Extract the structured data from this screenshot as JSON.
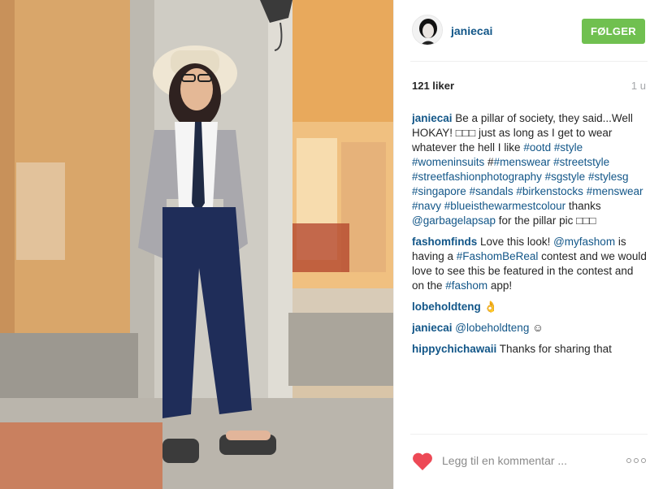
{
  "post": {
    "username": "janiecai",
    "follow_label": "FØLGER",
    "likes": "121 liker",
    "time": "1 u"
  },
  "comments": [
    {
      "user": "janiecai",
      "parts": [
        {
          "type": "text",
          "value": "Be a pillar of society, they said...Well HOKAY! "
        },
        {
          "type": "text",
          "value": "□□□"
        },
        {
          "type": "text",
          "value": " just as long as I get to wear whatever the hell I like "
        },
        {
          "type": "tag",
          "value": "#ootd"
        },
        {
          "type": "text",
          "value": " "
        },
        {
          "type": "tag",
          "value": "#style"
        },
        {
          "type": "text",
          "value": " "
        },
        {
          "type": "tag",
          "value": "#womeninsuits"
        },
        {
          "type": "text",
          "value": " #"
        },
        {
          "type": "tag",
          "value": "#menswear"
        },
        {
          "type": "text",
          "value": " "
        },
        {
          "type": "tag",
          "value": "#streetstyle"
        },
        {
          "type": "text",
          "value": " "
        },
        {
          "type": "tag",
          "value": "#streetfashionphotography"
        },
        {
          "type": "text",
          "value": " "
        },
        {
          "type": "tag",
          "value": "#sgstyle"
        },
        {
          "type": "text",
          "value": " "
        },
        {
          "type": "tag",
          "value": "#stylesg"
        },
        {
          "type": "text",
          "value": " "
        },
        {
          "type": "tag",
          "value": "#singapore"
        },
        {
          "type": "text",
          "value": " "
        },
        {
          "type": "tag",
          "value": "#sandals"
        },
        {
          "type": "text",
          "value": " "
        },
        {
          "type": "tag",
          "value": "#birkenstocks"
        },
        {
          "type": "text",
          "value": " "
        },
        {
          "type": "tag",
          "value": "#menswear"
        },
        {
          "type": "text",
          "value": " "
        },
        {
          "type": "tag",
          "value": "#navy"
        },
        {
          "type": "text",
          "value": " "
        },
        {
          "type": "tag",
          "value": "#blueisthewarmestcolour"
        },
        {
          "type": "text",
          "value": " thanks "
        },
        {
          "type": "mention",
          "value": "@garbagelapsap"
        },
        {
          "type": "text",
          "value": " for the pillar pic "
        },
        {
          "type": "text",
          "value": "□□□"
        }
      ]
    },
    {
      "user": "fashomfinds",
      "parts": [
        {
          "type": "text",
          "value": "Love this look! "
        },
        {
          "type": "mention",
          "value": "@myfashom"
        },
        {
          "type": "text",
          "value": " is having a "
        },
        {
          "type": "tag",
          "value": "#FashomBeReal"
        },
        {
          "type": "text",
          "value": " contest and we would love to see this be featured in the contest and on the "
        },
        {
          "type": "tag",
          "value": "#fashom"
        },
        {
          "type": "text",
          "value": " app!"
        }
      ]
    },
    {
      "user": "lobeholdteng",
      "parts": [
        {
          "type": "text",
          "value": "👌"
        }
      ]
    },
    {
      "user": "janiecai",
      "parts": [
        {
          "type": "mention",
          "value": "@lobeholdteng"
        },
        {
          "type": "text",
          "value": " ☺"
        }
      ]
    },
    {
      "user": "hippychichawaii",
      "parts": [
        {
          "type": "text",
          "value": "Thanks for sharing that"
        }
      ]
    }
  ],
  "footer": {
    "like_icon": "heart-icon",
    "comment_placeholder": "Legg til en kommentar ...",
    "more_icon": "more-options-icon"
  },
  "colors": {
    "link": "#125688",
    "follow_button": "#70c050",
    "heart": "#ed4956"
  }
}
